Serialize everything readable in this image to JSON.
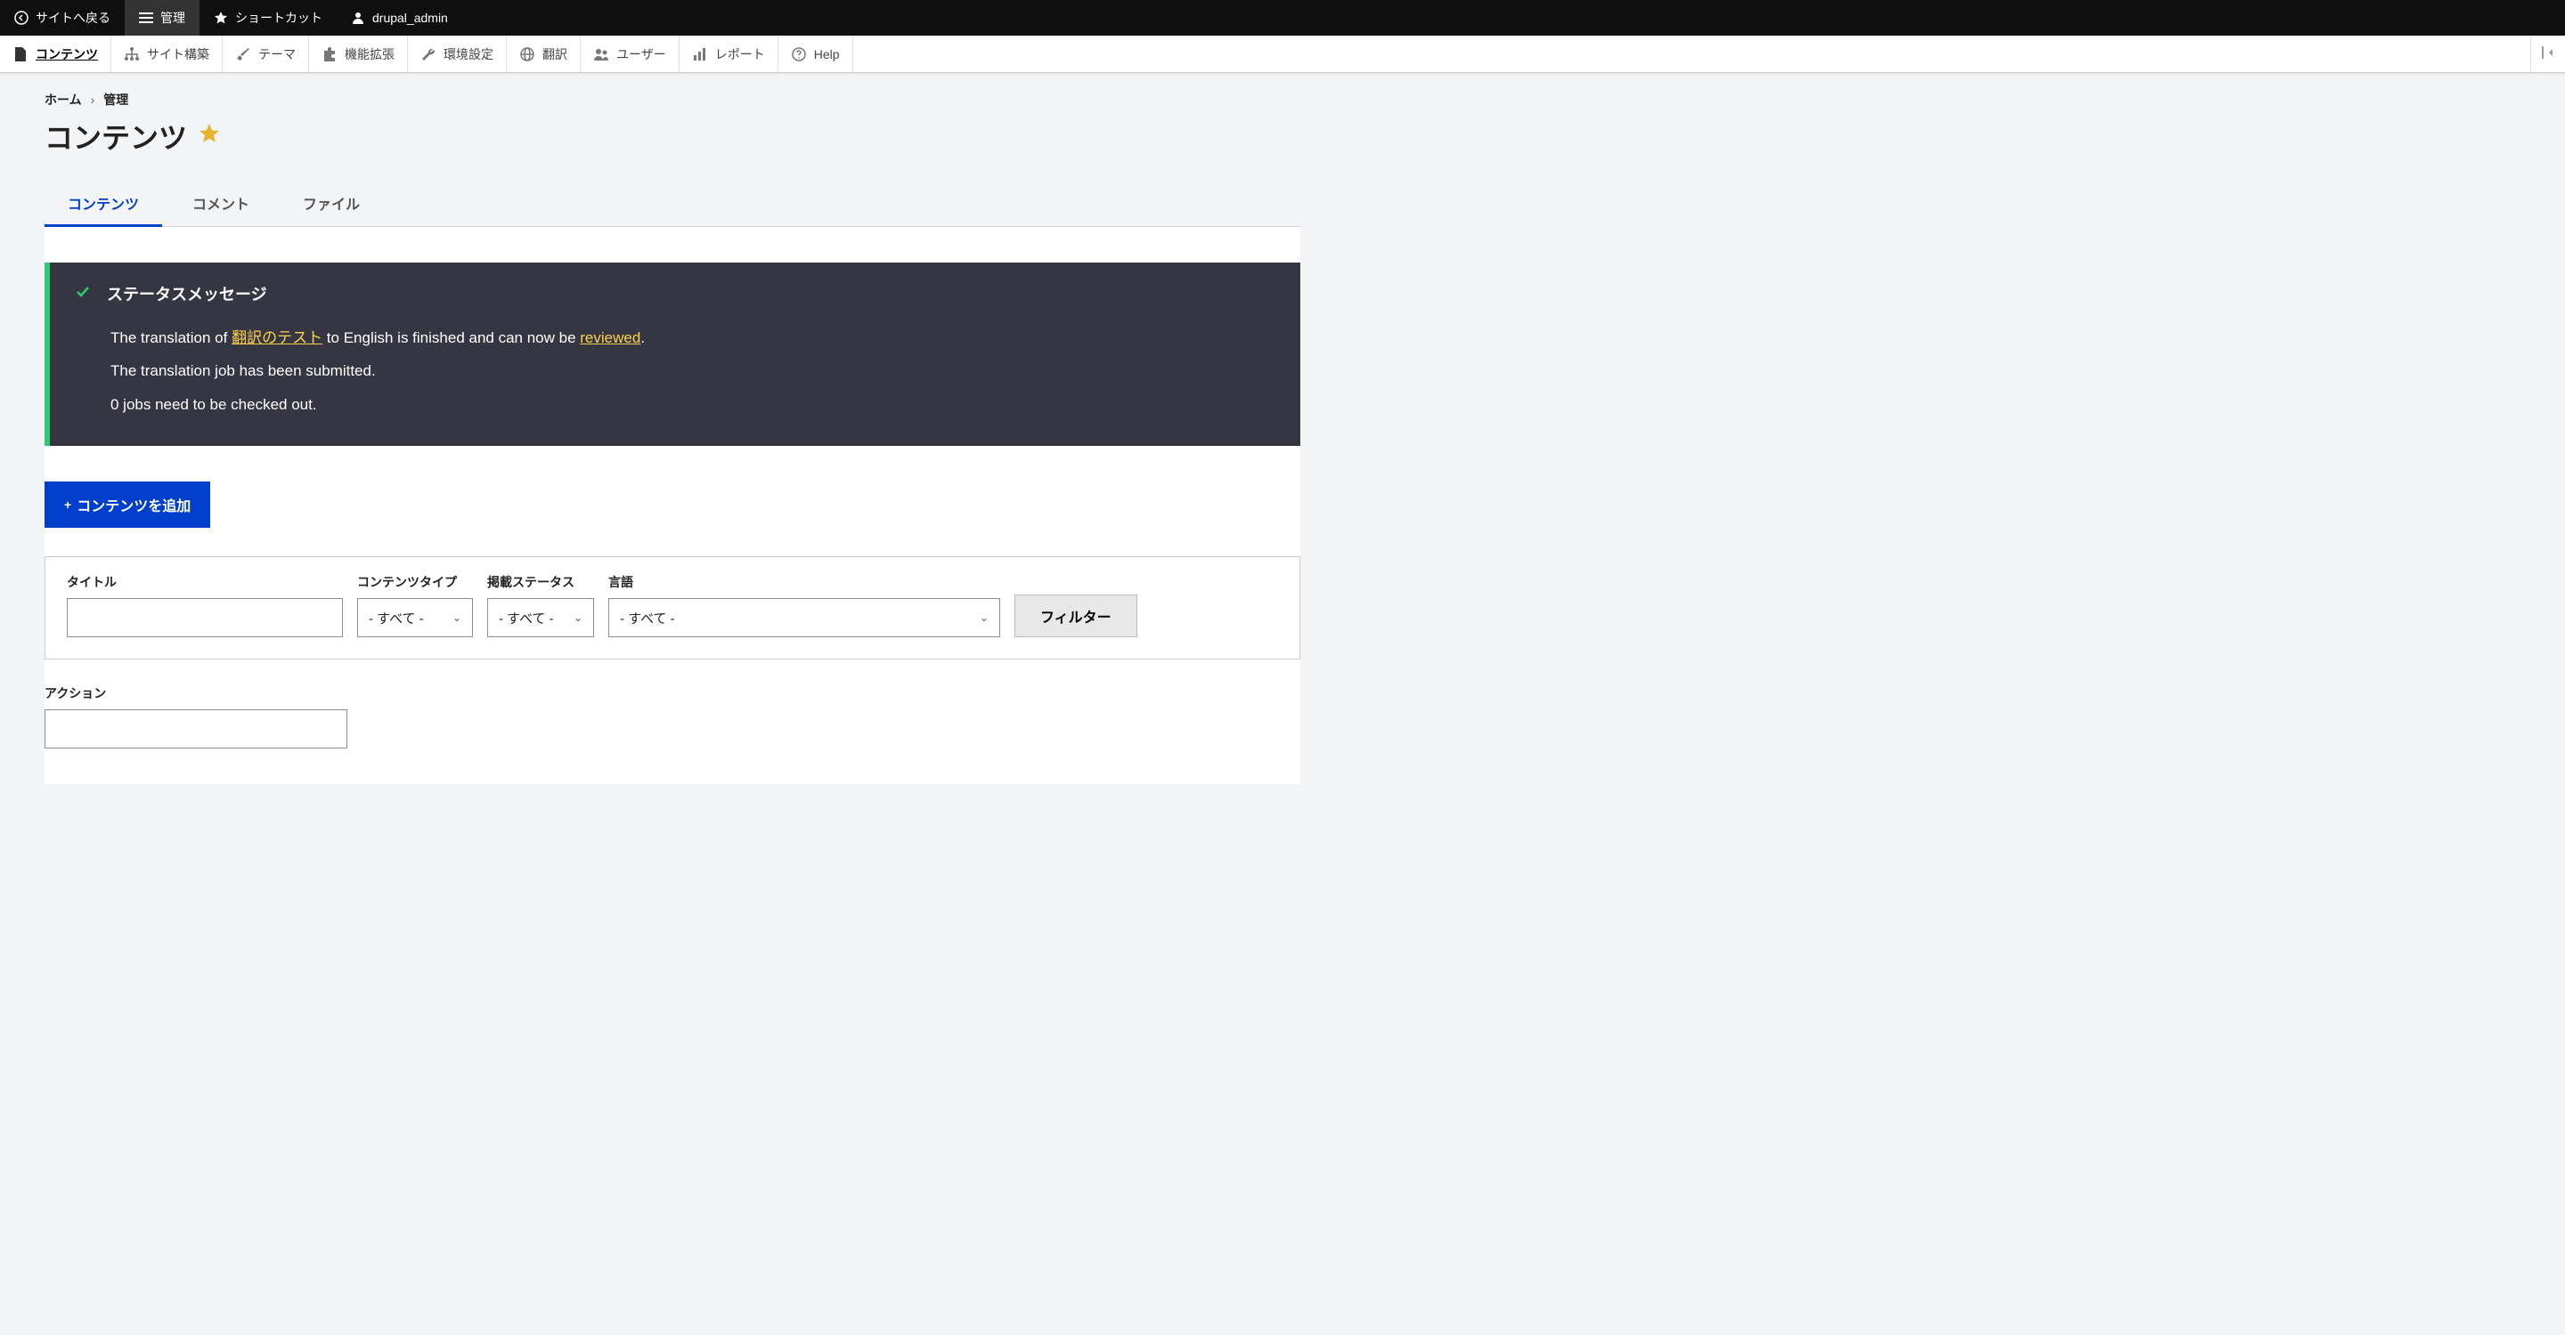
{
  "toolbar": {
    "back_to_site": "サイトへ戻る",
    "manage": "管理",
    "shortcuts": "ショートカット",
    "username": "drupal_admin"
  },
  "admin_menu": {
    "content": "コンテンツ",
    "structure": "サイト構築",
    "appearance": "テーマ",
    "extend": "機能拡張",
    "configuration": "環境設定",
    "translation": "翻訳",
    "people": "ユーザー",
    "reports": "レポート",
    "help": "Help"
  },
  "breadcrumb": {
    "home": "ホーム",
    "admin": "管理"
  },
  "page_title": "コンテンツ",
  "tabs": {
    "content": "コンテンツ",
    "comments": "コメント",
    "files": "ファイル"
  },
  "status": {
    "header": "ステータスメッセージ",
    "line1_pre": "The translation of ",
    "line1_link1": "翻訳のテスト",
    "line1_mid": " to English is finished and can now be ",
    "line1_link2": "reviewed",
    "line1_post": ".",
    "line2": "The translation job has been submitted.",
    "line3": "0 jobs need to be checked out."
  },
  "add_content_button": "コンテンツを追加",
  "filters": {
    "title_label": "タイトル",
    "type_label": "コンテンツタイプ",
    "type_value": "- すべて -",
    "status_label": "掲載ステータス",
    "status_value": "- すべて -",
    "language_label": "言語",
    "language_value": "- すべて -",
    "filter_button": "フィルター"
  },
  "action_label": "アクション"
}
